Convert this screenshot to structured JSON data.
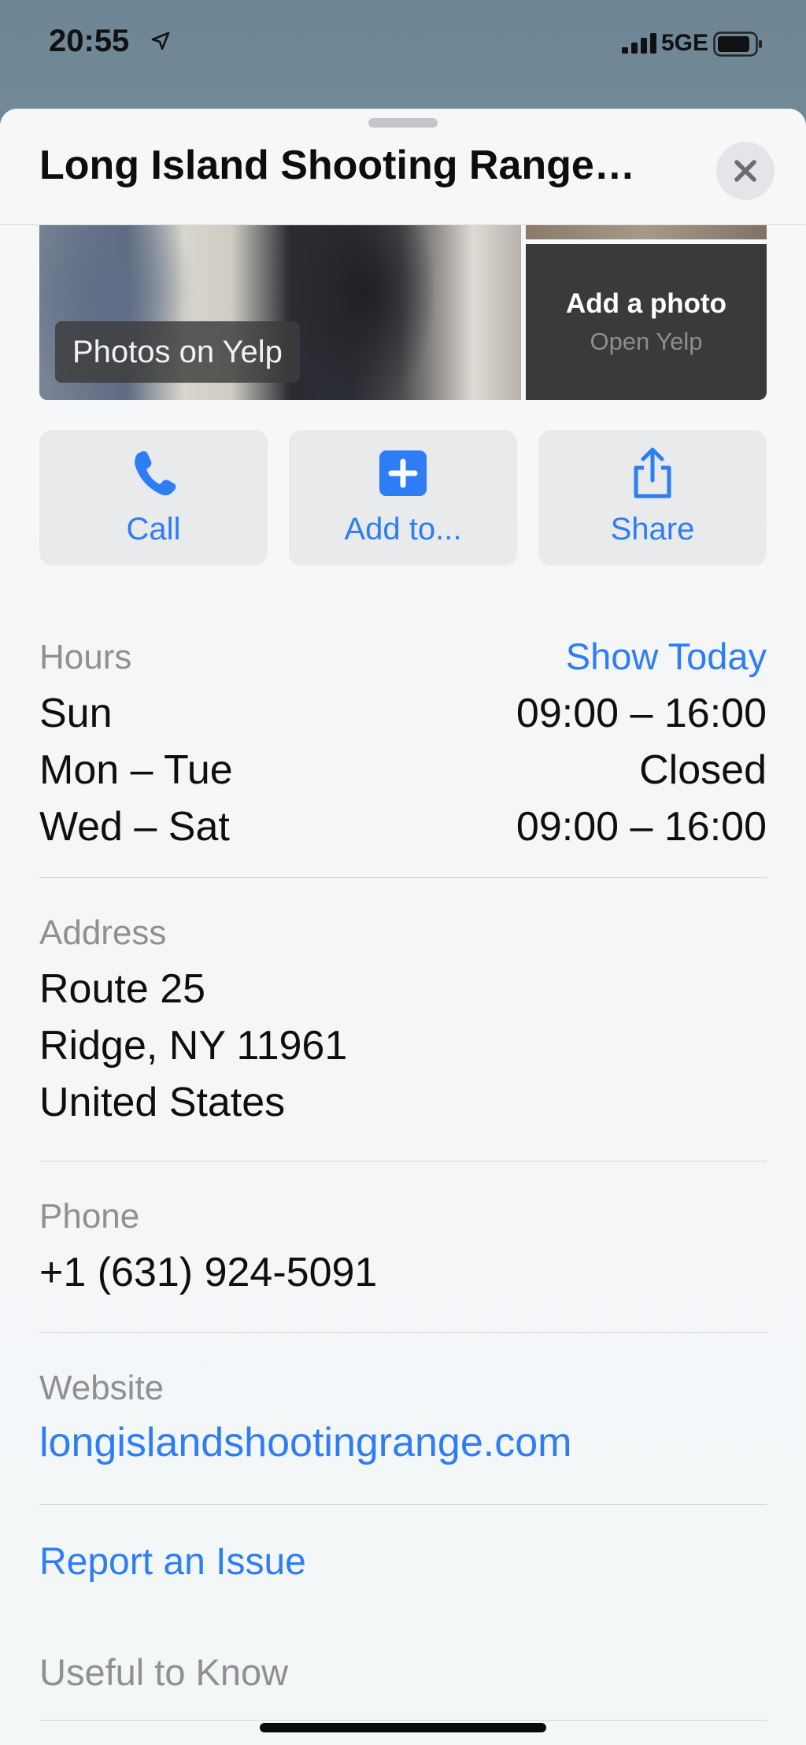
{
  "status_bar": {
    "time": "20:55",
    "network": "5GE",
    "icons": [
      "location-arrow-icon",
      "signal-icon",
      "battery-icon"
    ]
  },
  "sheet": {
    "title": "Long Island Shooting Range…",
    "close_icon": "close-icon"
  },
  "photos": {
    "main_label": "Photos on Yelp",
    "add_title": "Add a photo",
    "add_subtitle": "Open Yelp"
  },
  "actions": [
    {
      "label": "Call",
      "icon": "phone-icon"
    },
    {
      "label": "Add to...",
      "icon": "plus-square-icon"
    },
    {
      "label": "Share",
      "icon": "share-icon"
    }
  ],
  "hours": {
    "label": "Hours",
    "toggle": "Show Today",
    "rows": [
      {
        "days": "Sun",
        "time": "09:00 – 16:00"
      },
      {
        "days": "Mon – Tue",
        "time": "Closed"
      },
      {
        "days": "Wed – Sat",
        "time": "09:00 – 16:00"
      }
    ]
  },
  "address": {
    "label": "Address",
    "lines": [
      "Route 25",
      "Ridge, NY 11961",
      "United States"
    ]
  },
  "phone": {
    "label": "Phone",
    "value": "+1 (631) 924-5091"
  },
  "website": {
    "label": "Website",
    "value": "longislandshootingrange.com"
  },
  "report": {
    "label": "Report an Issue"
  },
  "useful": {
    "label": "Useful to Know"
  },
  "colors": {
    "accent": "#2d7df6",
    "secondary_text": "#8e9092",
    "primary_text": "#0e0e0e"
  }
}
